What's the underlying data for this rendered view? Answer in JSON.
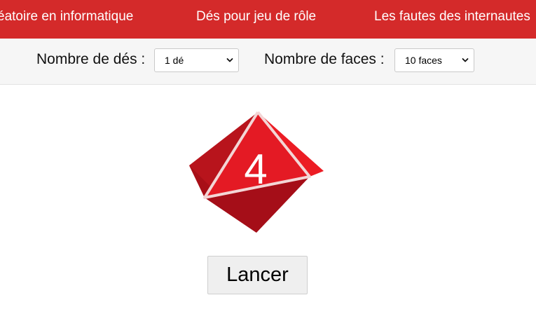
{
  "nav": {
    "items": [
      {
        "label": "éatoire en informatique"
      },
      {
        "label": "Dés pour jeu de rôle"
      },
      {
        "label": "Les fautes des internautes"
      }
    ]
  },
  "controls": {
    "dice_count": {
      "label": "Nombre de dés :",
      "selected": "1 dé"
    },
    "faces": {
      "label": "Nombre de faces :",
      "selected": "10 faces"
    }
  },
  "die": {
    "type": "d10",
    "value": "4"
  },
  "roll_button": {
    "label": "Lancer"
  },
  "colors": {
    "nav_bg": "#d42a2a",
    "die_red": "#e0202a"
  }
}
